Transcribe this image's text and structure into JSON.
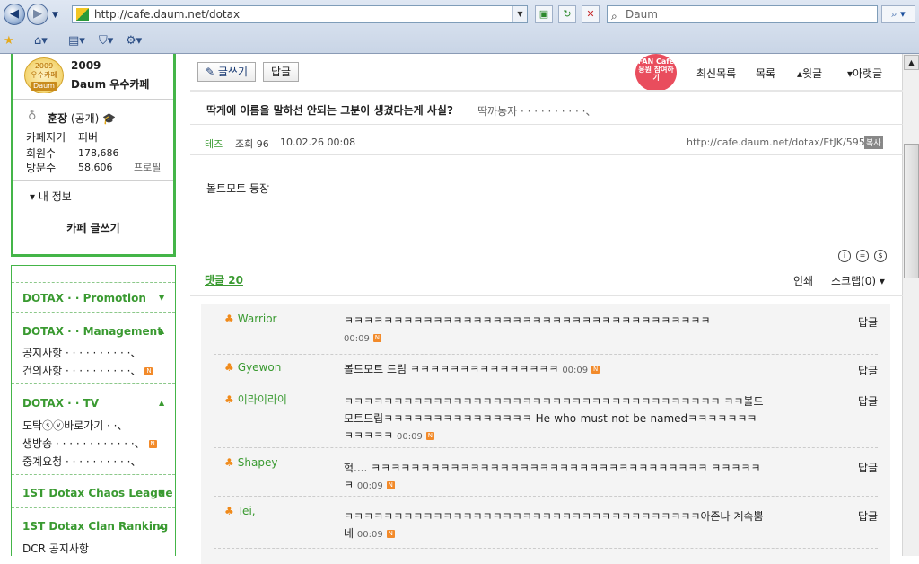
{
  "browser": {
    "url": "http://cafe.daum.net/dotax",
    "search_placeholder": "Daum"
  },
  "sidebar": {
    "badge_year": "2009",
    "badge_label": "우수카페",
    "badge_brand": "Daum",
    "cafe_year": "2009",
    "cafe_best": "Daum 우수카페",
    "owner_label": "훈장",
    "owner_status": "(공개)",
    "cafe_key_label": "카페지기",
    "cafe_key_value": "피버",
    "members_label": "회원수",
    "members_value": "178,686",
    "visits_label": "방문수",
    "visits_value": "58,606",
    "profile_link": "프로필",
    "my_info": "▾ 내 정보",
    "write": "카페 글쓰기"
  },
  "menu": {
    "groups": [
      {
        "title": "DOTAX · · Promotion"
      },
      {
        "title": "DOTAX · · Management"
      },
      {
        "title": "DOTAX · · TV"
      },
      {
        "title": "1ST Dotax Chaos League"
      },
      {
        "title": "1ST Dotax Clan Ranking"
      }
    ],
    "items": [
      {
        "label": "공지사항 · · · · · · · · · ·、"
      },
      {
        "label": "건의사항 · · · · · · · · · ·、"
      },
      {
        "label": "도탁ⓢⓥ바로가기 · ·、"
      },
      {
        "label": "생방송 · · · · · · · · · · · ·、"
      },
      {
        "label": "중계요청 · · · · · · · · · ·、"
      },
      {
        "label": "DCR 공지사항"
      }
    ]
  },
  "toolbar": {
    "write": "✎ 글쓰기",
    "reply": "답글",
    "fan_badge": "FAN Cafe 응원 참여하기",
    "list_recent": "최신목록",
    "list": "목록",
    "prev": "▴윗글",
    "next": "▾아랫글"
  },
  "post": {
    "title": "딱게에 이름을 말하선 안되는 그분이 생겼다는게 사실?",
    "subtitle": "딱까농자 · · · · · · · · · ·、",
    "author": "테즈",
    "views": "조회 96",
    "date": "10.02.26 00:08",
    "link": "http://cafe.daum.net/dotax/EtJK/59581",
    "copy": "복사",
    "body": "볼트모트 등장"
  },
  "comments_header": {
    "count_label": "댓글 20",
    "print": "인쇄",
    "scrap": "스크랩(0) ▾"
  },
  "comments": [
    {
      "author": "Warrior",
      "text": "ㅋㅋㅋㅋㅋㅋㅋㅋㅋㅋㅋㅋㅋㅋㅋㅋㅋㅋㅋㅋㅋㅋㅋㅋㅋㅋㅋㅋㅋㅋㅋㅋㅋㅋㅋㅋㅋ",
      "time": "00:09",
      "reply": "답글"
    },
    {
      "author": "Gyewon",
      "text": "볼드모트 드림 ㅋㅋㅋㅋㅋㅋㅋㅋㅋㅋㅋㅋㅋㅋㅋ",
      "time": "00:09",
      "reply": "답글"
    },
    {
      "author": "이라이라이",
      "text": "ㅋㅋㅋㅋㅋㅋㅋㅋㅋㅋㅋㅋㅋㅋㅋㅋㅋㅋㅋㅋㅋㅋㅋㅋㅋㅋㅋㅋㅋㅋㅋㅋㅋㅋㅋㅋㅋㅋ ㅋㅋ볼드모트드립ㅋㅋㅋㅋㅋㅋㅋㅋㅋㅋㅋㅋㅋㅋㅋ He-who-must-not-be-namedㅋㅋㅋㅋㅋㅋㅋㅋㅋㅋㅋㅋ",
      "time": "00:09",
      "reply": "답글"
    },
    {
      "author": "Shapey",
      "text": "헉.... ㅋㅋㅋㅋㅋㅋㅋㅋㅋㅋㅋㅋㅋㅋㅋㅋㅋㅋㅋㅋㅋㅋㅋㅋㅋㅋㅋㅋㅋㅋㅋㅋㅋㅋ ㅋㅋㅋㅋㅋㅋ",
      "time": "00:09",
      "reply": "답글"
    },
    {
      "author": "Tei,",
      "text": "ㅋㅋㅋㅋㅋㅋㅋㅋㅋㅋㅋㅋㅋㅋㅋㅋㅋㅋㅋㅋㅋㅋㅋㅋㅋㅋㅋㅋㅋㅋㅋㅋㅋㅋㅋㅋ아존나 계속뿜네",
      "time": "00:09",
      "reply": "답글"
    }
  ],
  "colors": {
    "accent_green": "#3a9a31",
    "border_green": "#44b548",
    "new_badge": "#f28a2a"
  }
}
